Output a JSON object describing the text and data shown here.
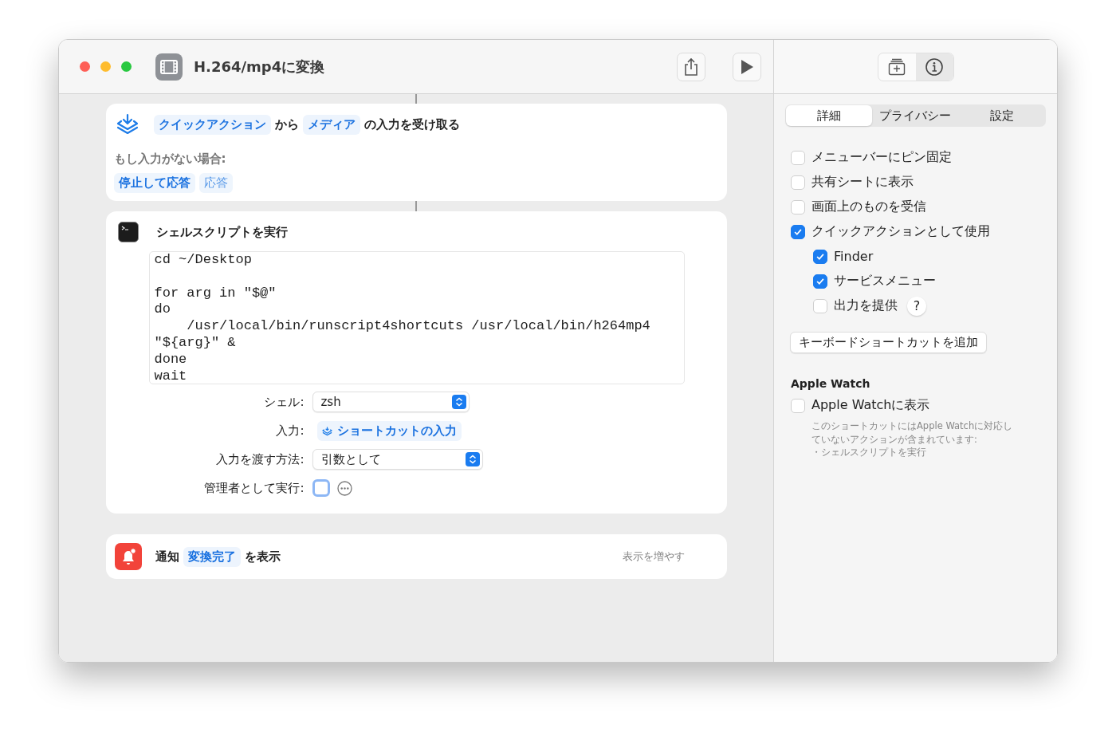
{
  "window": {
    "title": "H.264/mp4に変換"
  },
  "actions": [
    {
      "kind": "receive",
      "parts": [
        {
          "kind": "token",
          "text": "クイックアクション"
        },
        {
          "kind": "text",
          "text": "から"
        },
        {
          "kind": "token",
          "text": "メディア"
        },
        {
          "kind": "text",
          "text": "の入力を受け取る"
        }
      ],
      "no_input_label": "もし入力がない場合:",
      "no_input_options": [
        {
          "label": "停止して応答",
          "selected": true
        },
        {
          "label": "応答",
          "selected": false
        }
      ]
    },
    {
      "kind": "shell",
      "title": "シェルスクリプトを実行",
      "script": "cd ~/Desktop\n\nfor arg in \"$@\"\ndo\n    /usr/local/bin/runscript4shortcuts /usr/local/bin/h264mp4\n\"${arg}\" &\ndone\nwait",
      "params": [
        {
          "kind": "popup",
          "label": "シェル:",
          "value": "zsh"
        },
        {
          "kind": "token",
          "label": "入力:",
          "value": "ショートカットの入力"
        },
        {
          "kind": "popup",
          "label": "入力を渡す方法:",
          "value": "引数として"
        },
        {
          "kind": "checkbox",
          "label": "管理者として実行:",
          "checked": false
        }
      ]
    },
    {
      "kind": "notify",
      "parts": [
        {
          "kind": "text",
          "text": "通知"
        },
        {
          "kind": "token",
          "text": "変換完了"
        },
        {
          "kind": "text",
          "text": "を表示"
        }
      ],
      "more": "表示を増やす"
    }
  ],
  "inspector": {
    "tabs": [
      {
        "label": "詳細",
        "selected": true
      },
      {
        "label": "プライバシー",
        "selected": false
      },
      {
        "label": "設定",
        "selected": false
      }
    ],
    "options": [
      {
        "label": "メニューバーにピン固定",
        "checked": false
      },
      {
        "label": "共有シートに表示",
        "checked": false
      },
      {
        "label": "画面上のものを受信",
        "checked": false
      },
      {
        "label": "クイックアクションとして使用",
        "checked": true,
        "children": [
          {
            "label": "Finder",
            "checked": true
          },
          {
            "label": "サービスメニュー",
            "checked": true
          },
          {
            "label": "出力を提供",
            "checked": false,
            "help": "?"
          }
        ]
      }
    ],
    "shortcut_button": "キーボードショートカットを追加",
    "watch": {
      "heading": "Apple Watch",
      "option": {
        "label": "Apple Watchに表示",
        "checked": false
      },
      "note": "このショートカットにはApple Watchに対応していないアクションが含まれています:",
      "note_items": [
        "・シェルスクリプトを実行"
      ]
    }
  }
}
